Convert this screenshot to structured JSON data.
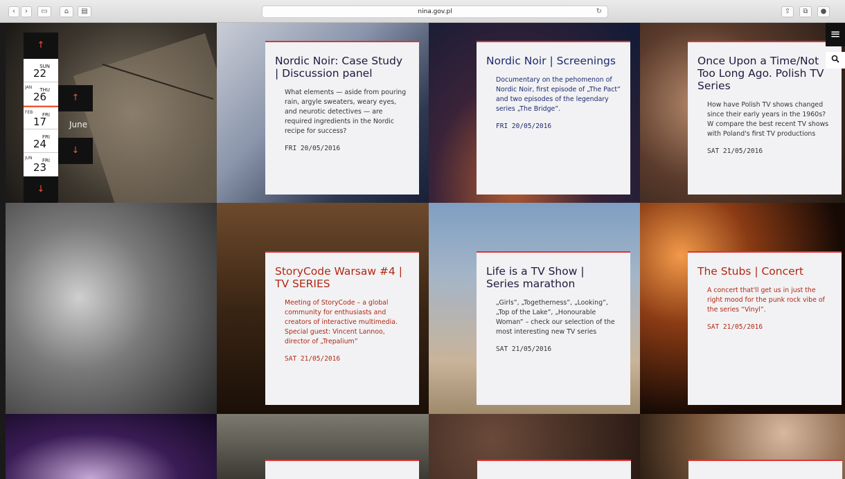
{
  "browser": {
    "url": "nina.gov.pl"
  },
  "calendar": {
    "days": [
      {
        "num": "22",
        "dow": "SUN",
        "mon": ""
      },
      {
        "num": "26",
        "dow": "THU",
        "mon": "JAN"
      },
      {
        "num": "17",
        "dow": "FRI",
        "mon": "FEB"
      },
      {
        "num": "24",
        "dow": "FRI",
        "mon": ""
      },
      {
        "num": "23",
        "dow": "FRI",
        "mon": "JUN"
      }
    ],
    "month_label": "June",
    "up_arrow": "↑",
    "down_arrow": "↓"
  },
  "menu_icon": "≡",
  "search_icon": "🔍",
  "events": [
    {
      "title": "Nordic Noir: Case Study | Discussion panel",
      "desc": "What elements — aside from pouring rain, argyle sweaters, weary eyes, and neurotic detectives — are required ingredients in the Nordic recipe for success?",
      "date": "FRI 20/05/2016"
    },
    {
      "title": "Nordic Noir | Screenings",
      "desc": "Documentary on the pehomenon of Nordic Noir, first episode of „The Pact” and two episodes of the legendary series „The Bridge”.",
      "date": "FRI 20/05/2016"
    },
    {
      "title": "Once Upon a Time/Not Too Long Ago. Polish TV Series",
      "desc": "How have Polish TV shows changed since their early years in the 1960s? W compare the best recent TV shows with Poland's first TV productions",
      "date": "SAT 21/05/2016"
    },
    {
      "title": "StoryCode Warsaw #4 | TV SERIES",
      "desc": "Meeting of StoryCode – a global community for enthusiasts and creators of interactive multimedia. Special guest: Vincent Lannoo, director of „Trepalium”",
      "date": "SAT 21/05/2016"
    },
    {
      "title": "Life is a TV Show | Series marathon",
      "desc": "„Girls”, „Togetherness”, „Looking”, „Top of the Lake”, „Honourable Woman” – check our selection of the most interesting new TV series",
      "date": "SAT 21/05/2016"
    },
    {
      "title": "The Stubs | Concert",
      "desc": "A concert that'll get us in just the right mood for the punk rock vibe of the series “Vinyl”.",
      "date": "SAT 21/05/2016"
    }
  ]
}
